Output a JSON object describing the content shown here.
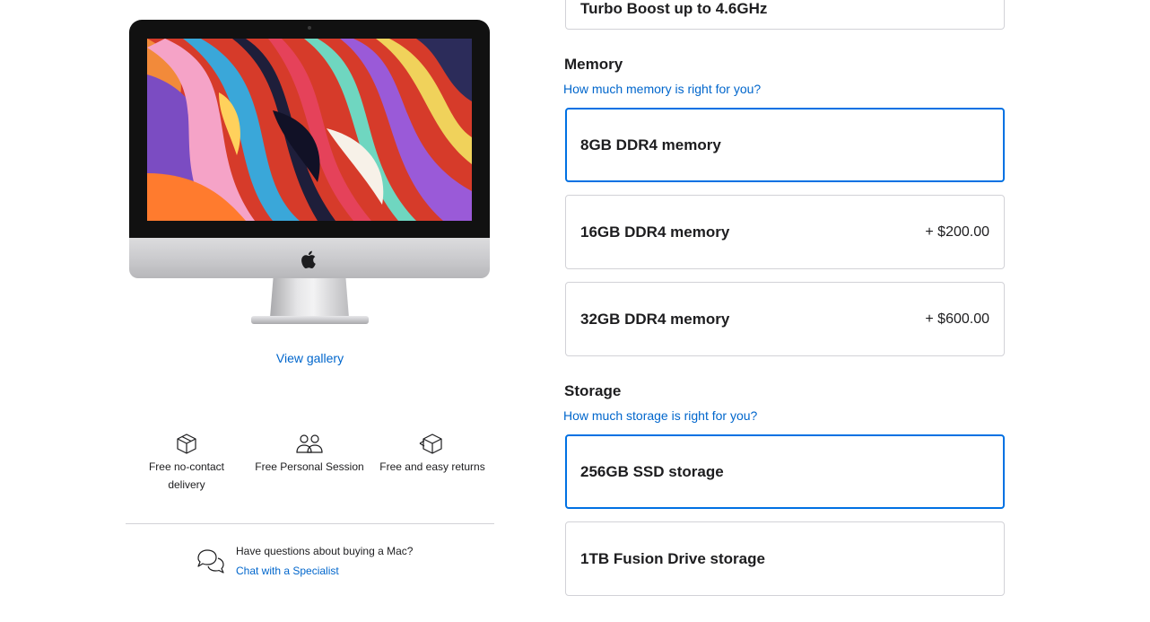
{
  "gallery": {
    "link_label": "View gallery"
  },
  "perks": [
    {
      "icon": "box-icon",
      "label": "Free no-contact delivery"
    },
    {
      "icon": "people-icon",
      "label": "Free Personal Session"
    },
    {
      "icon": "return-box-icon",
      "label": "Free and easy returns"
    }
  ],
  "help": {
    "icon": "chat-bubbles-icon",
    "title": "Have questions about buying a Mac?",
    "link": "Chat with a Specialist"
  },
  "processor": {
    "selected_option_partial": "Turbo Boost up to 4.6GHz"
  },
  "memory": {
    "title": "Memory",
    "help_link": "How much memory is right for you?",
    "options": [
      {
        "label": "8GB DDR4 memory",
        "price": "",
        "selected": true
      },
      {
        "label": "16GB DDR4 memory",
        "price": "+ $200.00",
        "selected": false
      },
      {
        "label": "32GB DDR4 memory",
        "price": "+ $600.00",
        "selected": false
      }
    ]
  },
  "storage": {
    "title": "Storage",
    "help_link": "How much storage is right for you?",
    "options": [
      {
        "label": "256GB SSD storage",
        "price": "",
        "selected": true
      },
      {
        "label": "1TB Fusion Drive storage",
        "price": "",
        "selected": false
      }
    ]
  },
  "colors": {
    "link": "#0066cc",
    "selected_border": "#0071e3",
    "border": "#d2d2d7",
    "text": "#1d1d1f"
  }
}
